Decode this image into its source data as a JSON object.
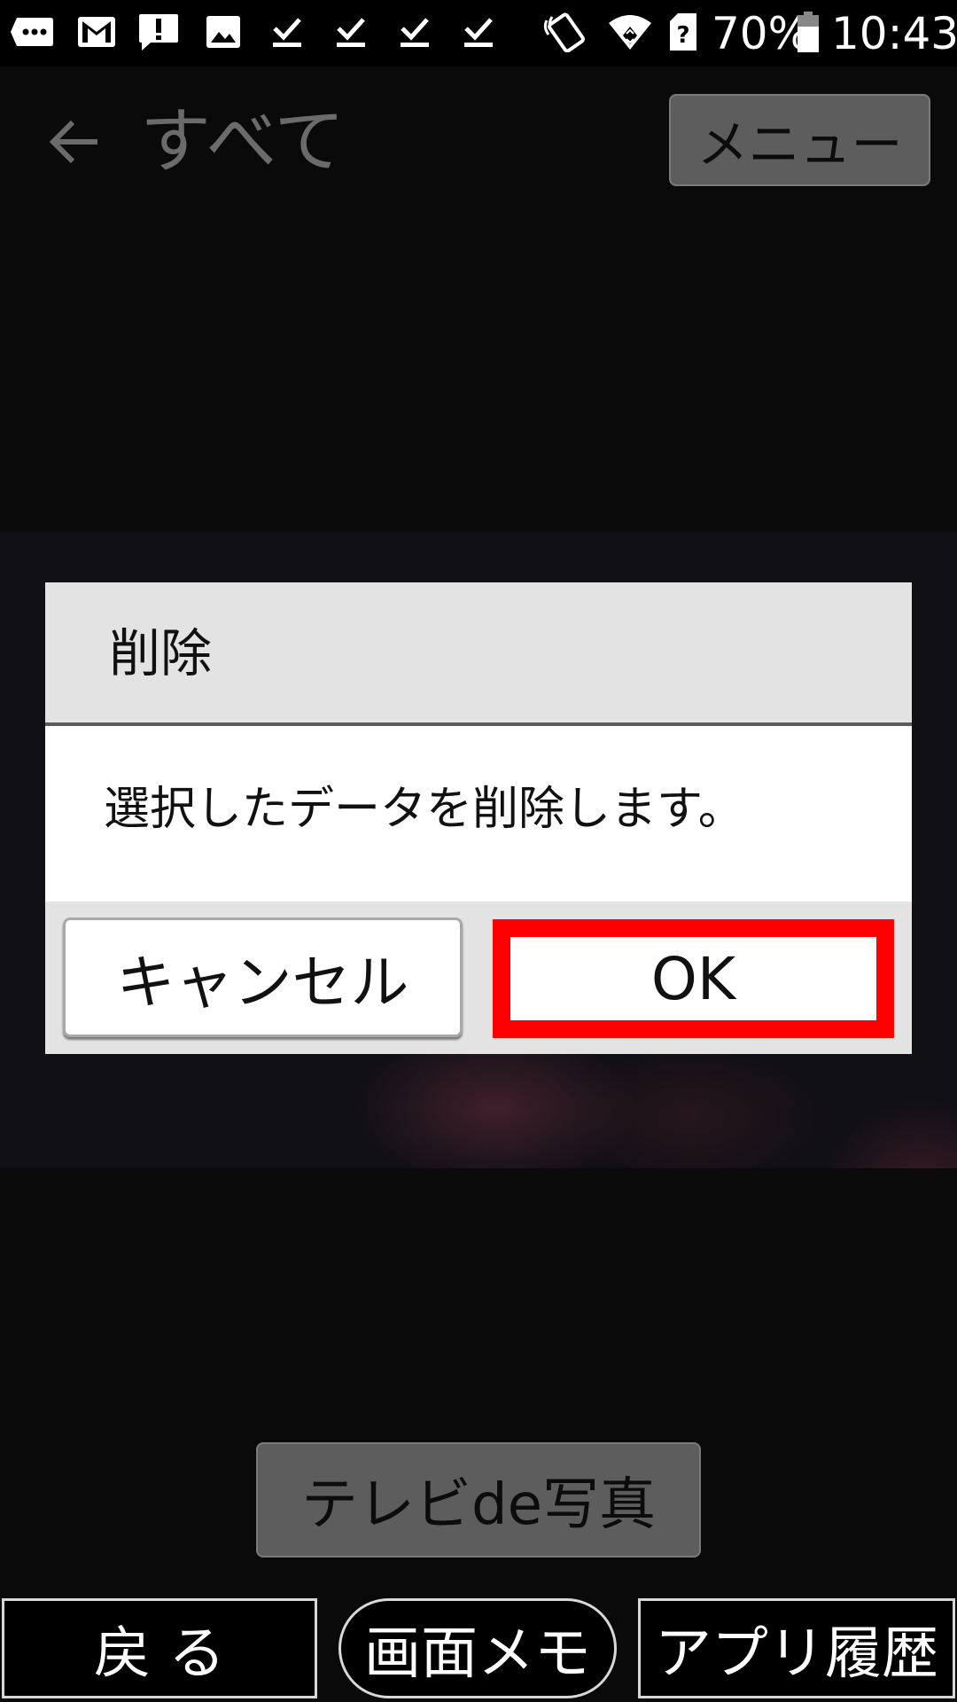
{
  "status_bar": {
    "battery": "70%",
    "time": "10:43",
    "icons": [
      "sms-icon",
      "gmail-icon",
      "alert-icon",
      "image-icon",
      "download-done-icon",
      "download-done-icon",
      "download-done-icon",
      "download-done-icon",
      "nfc-icon",
      "wifi-icon",
      "sim-unknown-icon",
      "battery-icon"
    ]
  },
  "app_bar": {
    "title": "すべて",
    "menu_label": "メニュー"
  },
  "dialog": {
    "title": "削除",
    "message": "選択したデータを削除します。",
    "cancel_label": "キャンセル",
    "ok_label": "OK",
    "highlight_color": "#ff0000"
  },
  "tv_button_label": "テレビde写真",
  "bottom_nav": {
    "back_label": "戻 る",
    "memo_label": "画面メモ",
    "history_label": "アプリ履歴"
  }
}
